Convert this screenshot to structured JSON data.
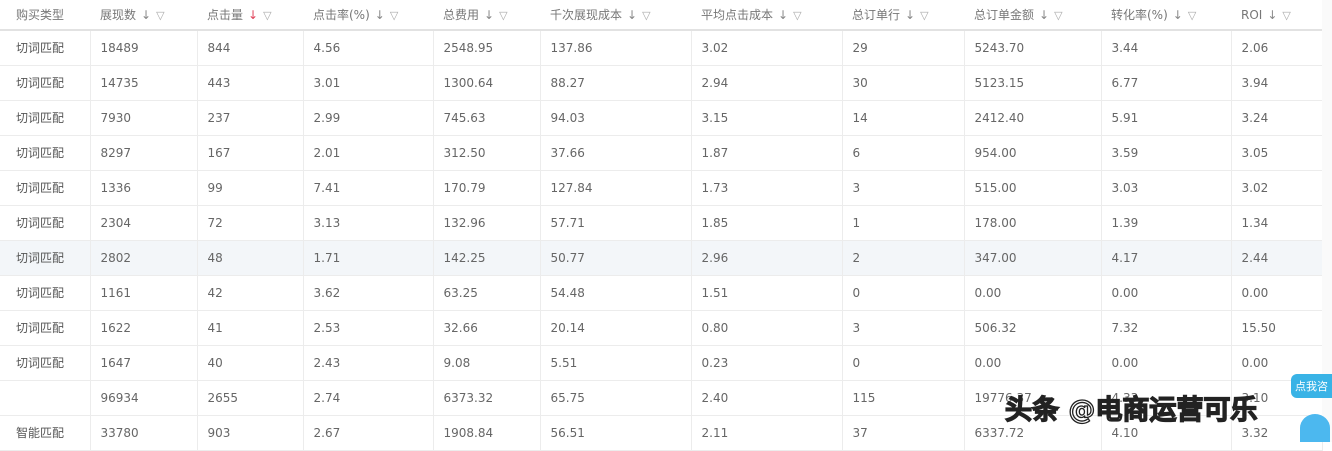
{
  "columns": [
    "购买类型",
    "展现数",
    "点击量",
    "点击率(%)",
    "总费用",
    "千次展现成本",
    "平均点击成本",
    "总订单行",
    "总订单金额",
    "转化率(%)",
    "ROI"
  ],
  "sort_active_column": 2,
  "rows": [
    [
      "切词匹配",
      "18489",
      "844",
      "4.56",
      "2548.95",
      "137.86",
      "3.02",
      "29",
      "5243.70",
      "3.44",
      "2.06"
    ],
    [
      "切词匹配",
      "14735",
      "443",
      "3.01",
      "1300.64",
      "88.27",
      "2.94",
      "30",
      "5123.15",
      "6.77",
      "3.94"
    ],
    [
      "切词匹配",
      "7930",
      "237",
      "2.99",
      "745.63",
      "94.03",
      "3.15",
      "14",
      "2412.40",
      "5.91",
      "3.24"
    ],
    [
      "切词匹配",
      "8297",
      "167",
      "2.01",
      "312.50",
      "37.66",
      "1.87",
      "6",
      "954.00",
      "3.59",
      "3.05"
    ],
    [
      "切词匹配",
      "1336",
      "99",
      "7.41",
      "170.79",
      "127.84",
      "1.73",
      "3",
      "515.00",
      "3.03",
      "3.02"
    ],
    [
      "切词匹配",
      "2304",
      "72",
      "3.13",
      "132.96",
      "57.71",
      "1.85",
      "1",
      "178.00",
      "1.39",
      "1.34"
    ],
    [
      "切词匹配",
      "2802",
      "48",
      "1.71",
      "142.25",
      "50.77",
      "2.96",
      "2",
      "347.00",
      "4.17",
      "2.44"
    ],
    [
      "切词匹配",
      "1161",
      "42",
      "3.62",
      "63.25",
      "54.48",
      "1.51",
      "0",
      "0.00",
      "0.00",
      "0.00"
    ],
    [
      "切词匹配",
      "1622",
      "41",
      "2.53",
      "32.66",
      "20.14",
      "0.80",
      "3",
      "506.32",
      "7.32",
      "15.50"
    ],
    [
      "切词匹配",
      "1647",
      "40",
      "2.43",
      "9.08",
      "5.51",
      "0.23",
      "0",
      "0.00",
      "0.00",
      "0.00"
    ],
    [
      "",
      "96934",
      "2655",
      "2.74",
      "6373.32",
      "65.75",
      "2.40",
      "115",
      "19776.37",
      "4.33",
      "3.10"
    ],
    [
      "智能匹配",
      "33780",
      "903",
      "2.67",
      "1908.84",
      "56.51",
      "2.11",
      "37",
      "6337.72",
      "4.10",
      "3.32"
    ]
  ],
  "highlight_row": 6,
  "watermark": "头条 @电商运营可乐",
  "chat_bubble": "点我咨"
}
